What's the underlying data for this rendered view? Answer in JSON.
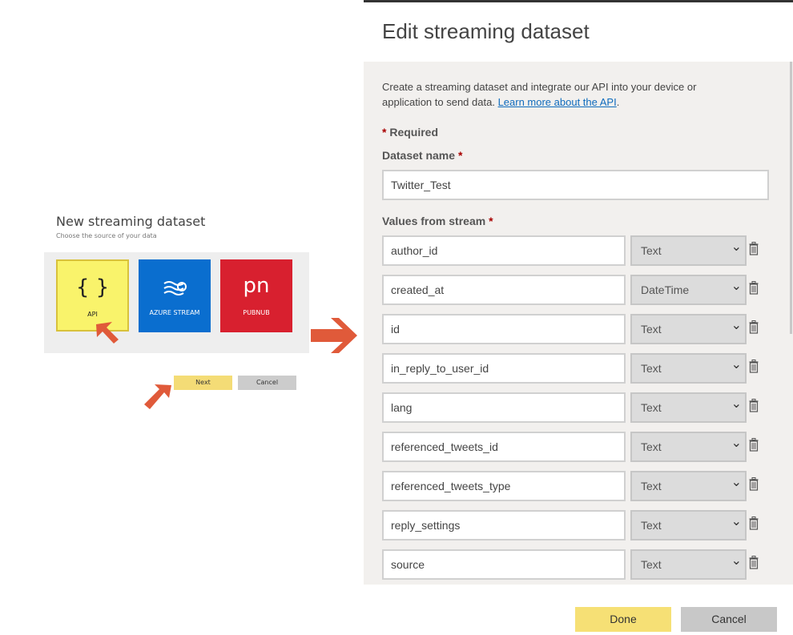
{
  "new_dataset": {
    "title": "New streaming dataset",
    "subtitle": "Choose the source of your data",
    "tiles": [
      {
        "glyph": "{ }",
        "label": "API",
        "selected": true
      },
      {
        "icon": "azure-stream-icon",
        "label": "AZURE STREAM"
      },
      {
        "glyph": "pn",
        "label": "PUBNUB"
      }
    ],
    "next_label": "Next",
    "cancel_label": "Cancel"
  },
  "edit": {
    "title": "Edit streaming dataset",
    "description": "Create a streaming dataset and integrate our API into your device or application to send data.",
    "learn_more": "Learn more about the API",
    "description_end": ".",
    "required_mark": "*",
    "required_label": "Required",
    "dataset_name_label": "Dataset name",
    "dataset_name_value": "Twitter_Test",
    "values_label": "Values from stream",
    "fields": [
      {
        "name": "author_id",
        "type": "Text"
      },
      {
        "name": "created_at",
        "type": "DateTime"
      },
      {
        "name": "id",
        "type": "Text"
      },
      {
        "name": "in_reply_to_user_id",
        "type": "Text"
      },
      {
        "name": "lang",
        "type": "Text"
      },
      {
        "name": "referenced_tweets_id",
        "type": "Text"
      },
      {
        "name": "referenced_tweets_type",
        "type": "Text"
      },
      {
        "name": "reply_settings",
        "type": "Text"
      },
      {
        "name": "source",
        "type": "Text"
      }
    ]
  },
  "footer": {
    "done_label": "Done",
    "cancel_label": "Cancel"
  },
  "colors": {
    "accent_yellow": "#f6e075",
    "arrow": "#e05a3a",
    "api_tile": "#f9f36b",
    "azure_tile": "#0a6ecf",
    "pubnub_tile": "#d8202f"
  }
}
